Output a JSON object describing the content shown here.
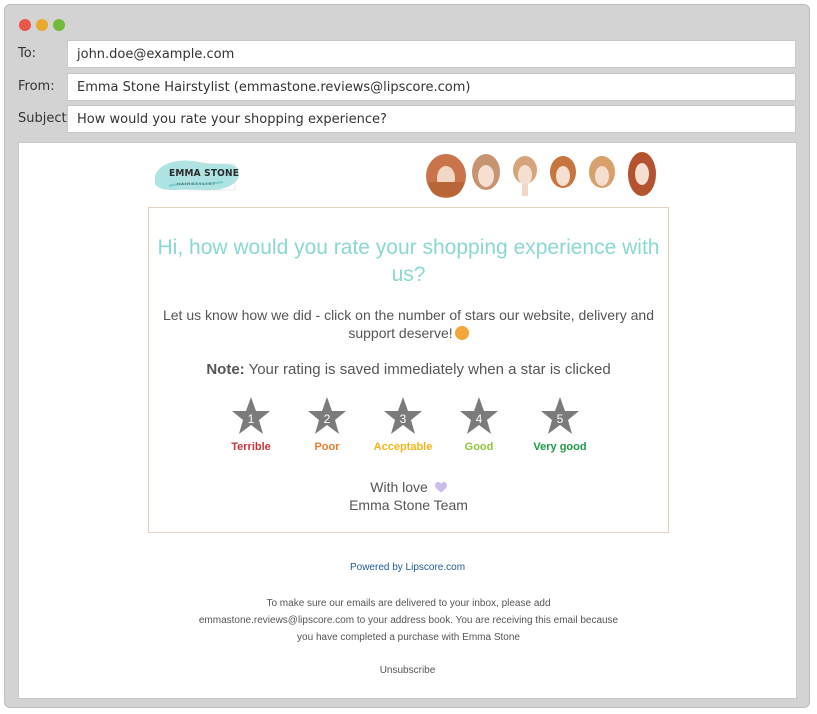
{
  "window": {
    "controls": [
      "close",
      "minimize",
      "maximize"
    ]
  },
  "header": {
    "to_label": "To:",
    "to_value": "john.doe@example.com",
    "from_label": "From:",
    "from_value": "Emma Stone Hairstylist (emmastone.reviews@lipscore.com)",
    "subject_label": "Subject:",
    "subject_value": "How would you rate your shopping experience?"
  },
  "email": {
    "logo_text": "EMMA STONE",
    "logo_subtext": "HAIRSTYLIST",
    "title": "Hi, how would you rate your shopping experience with us?",
    "intro": "Let us know how we did - click on the number of stars our website, delivery and support deserve!",
    "note_label": "Note:",
    "note_text": "Your rating is saved immediately when a star is clicked",
    "ratings": [
      {
        "num": "1",
        "label": "Terrible",
        "color": "#c9353a"
      },
      {
        "num": "2",
        "label": "Poor",
        "color": "#e97a2a"
      },
      {
        "num": "3",
        "label": "Acceptable",
        "color": "#f2b51b"
      },
      {
        "num": "4",
        "label": "Good",
        "color": "#8fc43b"
      },
      {
        "num": "5",
        "label": "Very good",
        "color": "#1d9a47"
      }
    ],
    "signoff_line1": "With love",
    "signoff_line2": "Emma Stone Team",
    "powered_by": "Powered by Lipscore.com",
    "footer_text": "To make sure our emails are delivered to your inbox, please add emmastone.reviews@lipscore.com to your address book. You are receiving this email because you have completed a purchase with Emma Stone",
    "unsubscribe": "Unsubscribe"
  },
  "colors": {
    "accent_title": "#8ad8d1",
    "star_fill": "#7b7b7b",
    "link": "#1e5a8f"
  }
}
